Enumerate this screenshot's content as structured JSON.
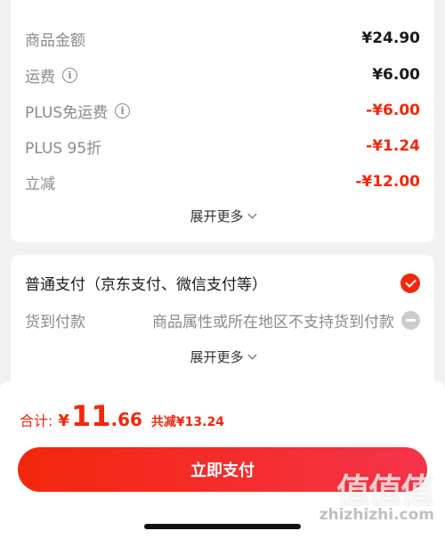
{
  "price_card": {
    "rows": [
      {
        "label": "商品金额",
        "value": "¥24.90",
        "info": false,
        "red": false
      },
      {
        "label": "运费",
        "value": "¥6.00",
        "info": true,
        "red": false
      },
      {
        "label": "PLUS免运费",
        "value": "-¥6.00",
        "info": true,
        "red": true
      },
      {
        "label": "PLUS 95折",
        "value": "-¥1.24",
        "info": false,
        "red": true
      },
      {
        "label": "立减",
        "value": "-¥12.00",
        "info": false,
        "red": true
      }
    ],
    "expand_label": "展开更多"
  },
  "payment_card": {
    "main_option": "普通支付（京东支付、微信支付等）",
    "cod_label": "货到付款",
    "cod_note": "商品属性或所在地区不支持货到付款",
    "expand_label": "展开更多"
  },
  "bottom": {
    "total_label": "合计:",
    "currency": "¥",
    "total_int": "11",
    "total_dec": ".66",
    "discount": "共减¥13.24",
    "pay_button": "立即支付"
  },
  "watermark": {
    "main": "值值值",
    "sub": "zhizhizhi.com"
  },
  "colors": {
    "accent": "#f2270c",
    "muted": "#8a8a8a",
    "background": "#f2f2f2"
  }
}
